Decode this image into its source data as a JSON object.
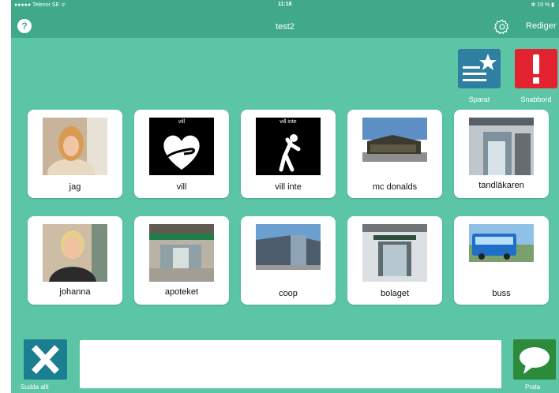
{
  "status_bar": {
    "carrier": "●●●●● Telenor SE ᯤ",
    "time": "11:18",
    "battery": "✻ 19 % ▮"
  },
  "header": {
    "help_label": "?",
    "title": "test2",
    "edit_label": "Rediger"
  },
  "quick_buttons": {
    "saved_label": "Sparat",
    "alarm_label": "Snabbord"
  },
  "tiles": [
    {
      "label": "jag"
    },
    {
      "label": "vill",
      "caption": "vill"
    },
    {
      "label": "vill inte",
      "caption": "vill inte"
    },
    {
      "label": "mc donalds"
    },
    {
      "label": "tandläkaren"
    },
    {
      "label": "johanna"
    },
    {
      "label": "apoteket"
    },
    {
      "label": "coop"
    },
    {
      "label": "bolaget"
    },
    {
      "label": "buss"
    }
  ],
  "bottom": {
    "delete_label": "Sudda allt",
    "text_value": "",
    "speak_label": "Prata"
  },
  "colors": {
    "background": "#5cc5a6",
    "header": "#3fa98a",
    "saved": "#2f7fa2",
    "alarm": "#e2232f",
    "delete": "#1c7f91",
    "speak": "#2c8b3b"
  }
}
